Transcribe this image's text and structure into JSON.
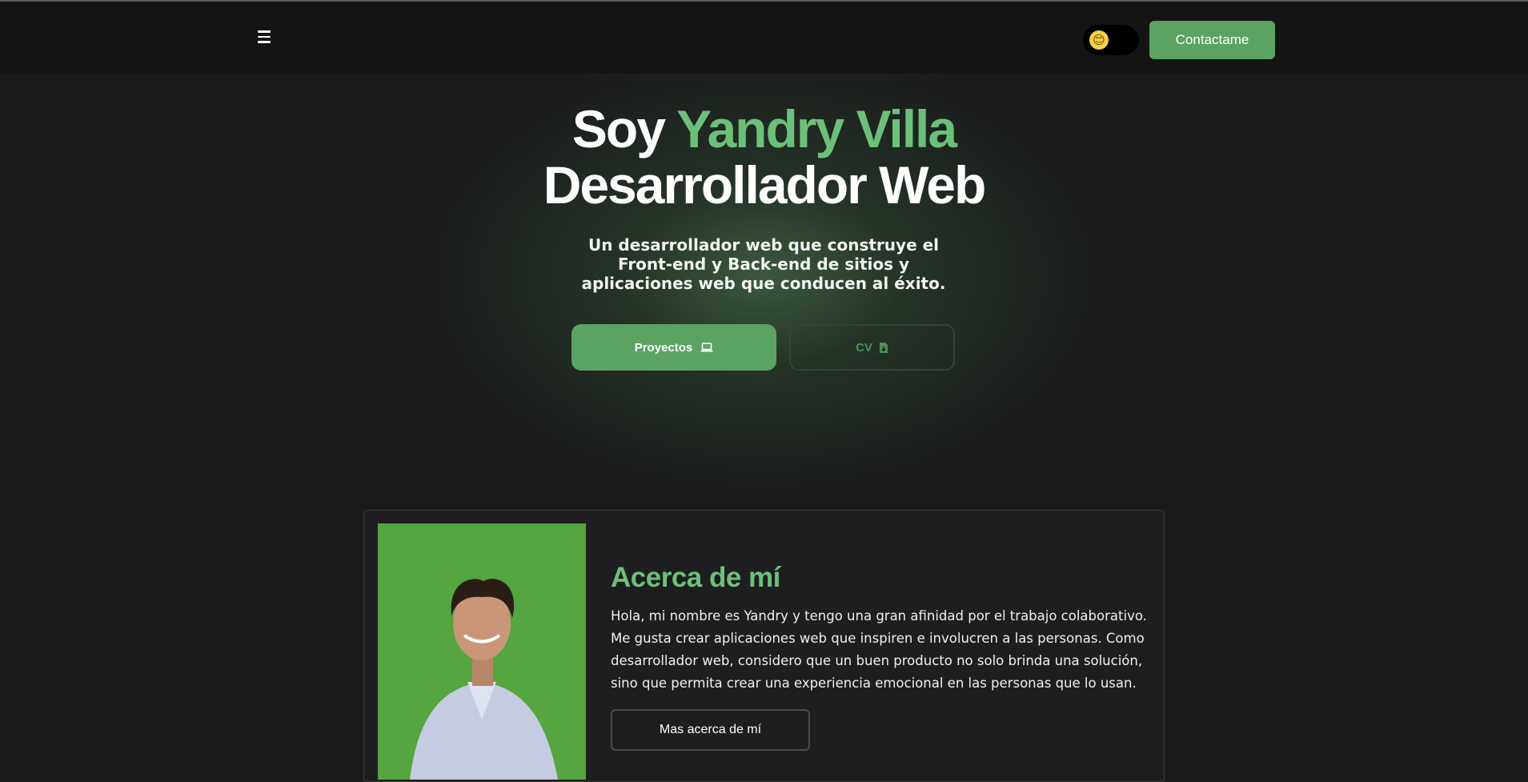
{
  "nav": {
    "contact_label": "Contactame",
    "theme_icon": "😊"
  },
  "hero": {
    "title_prefix": "Soy ",
    "title_name": "Yandry Villa",
    "title_role": "Desarrollador Web",
    "subtitle": "Un desarrollador web que construye el Front-end y Back-end de sitios y aplicaciones web que conducen al éxito.",
    "projects_label": "Proyectos",
    "cv_label": "CV"
  },
  "about": {
    "title": "Acerca de mí",
    "text": "Hola, mi nombre es Yandry y tengo una gran afinidad por el trabajo colaborativo. Me gusta crear aplicaciones web que inspiren e involucren a las personas. Como desarrollador web, considero que un buen producto no solo brinda una solución, sino que permita crear una experiencia emocional en las personas que lo usan.",
    "more_label": "Mas acerca de mí"
  },
  "colors": {
    "accent": "#6cc07a",
    "button": "#5ba363",
    "background": "#1a1a1b",
    "photo_bg": "#55a540"
  }
}
